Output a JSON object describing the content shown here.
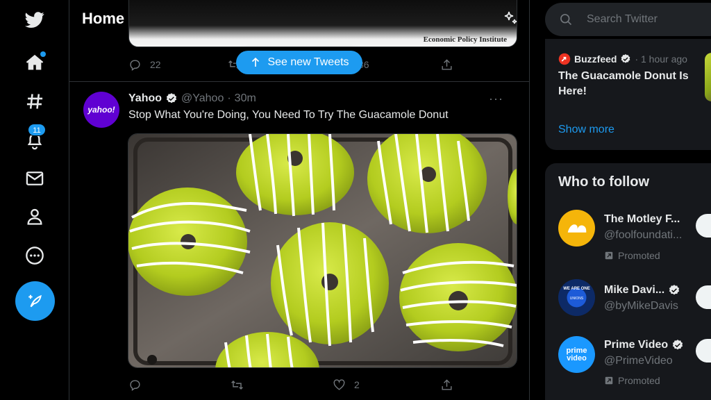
{
  "colors": {
    "accent": "#1d9bf0",
    "background": "#000000",
    "card": "#16181c",
    "muted": "#71767b",
    "text": "#e7e9ea",
    "yahoo_purple": "#6001d2"
  },
  "nav": {
    "items": [
      {
        "name": "twitter-logo",
        "icon": "twitter-bird-icon"
      },
      {
        "name": "home",
        "icon": "home-icon",
        "has_dot": true
      },
      {
        "name": "explore",
        "icon": "hashtag-icon"
      },
      {
        "name": "notifications",
        "icon": "bell-icon",
        "badge": "11"
      },
      {
        "name": "messages",
        "icon": "envelope-icon"
      },
      {
        "name": "profile",
        "icon": "person-icon"
      },
      {
        "name": "more",
        "icon": "more-circle-icon"
      }
    ],
    "compose_icon": "compose-feather-icon"
  },
  "header": {
    "title": "Home",
    "icon": "sparkle-icon"
  },
  "prev_tweet": {
    "media_caption": "Economic Policy Institute",
    "reply_count": "22",
    "retweet_count": "",
    "like_count": "36"
  },
  "new_tweets_pill": {
    "label": "See new Tweets"
  },
  "tweet": {
    "avatar_text": "yahoo!",
    "name": "Yahoo",
    "handle": "@Yahoo",
    "separator": "·",
    "time": "30m",
    "text": "Stop What You're Doing, You Need To Try The Guacamole Donut",
    "reply_count": "",
    "retweet_count": "",
    "like_count": "2",
    "more_label": "···"
  },
  "search": {
    "placeholder": "Search Twitter"
  },
  "trend": {
    "source": "Buzzfeed",
    "time": "· 1 hour ago",
    "title": "The Guacamole Donut Is Here!",
    "show_more": "Show more"
  },
  "who_to_follow": {
    "title": "Who to follow",
    "accounts": [
      {
        "name": "The Motley F...",
        "handle": "@foolfoundati...",
        "verified": false,
        "promoted": "Promoted",
        "avatar_color": "#f5b50a"
      },
      {
        "name": "Mike Davi...",
        "handle": "@byMikeDavis",
        "verified": true,
        "promoted": "",
        "avatar_text": "WE ARE ONE GANNETT UNIONS #FAIRPAYGANNETT",
        "avatar_color": "#0d2a66"
      },
      {
        "name": "Prime Video",
        "handle": "@PrimeVideo",
        "verified": true,
        "promoted": "Promoted",
        "avatar_text": "prime video",
        "avatar_color": "#1a98ff"
      }
    ]
  }
}
